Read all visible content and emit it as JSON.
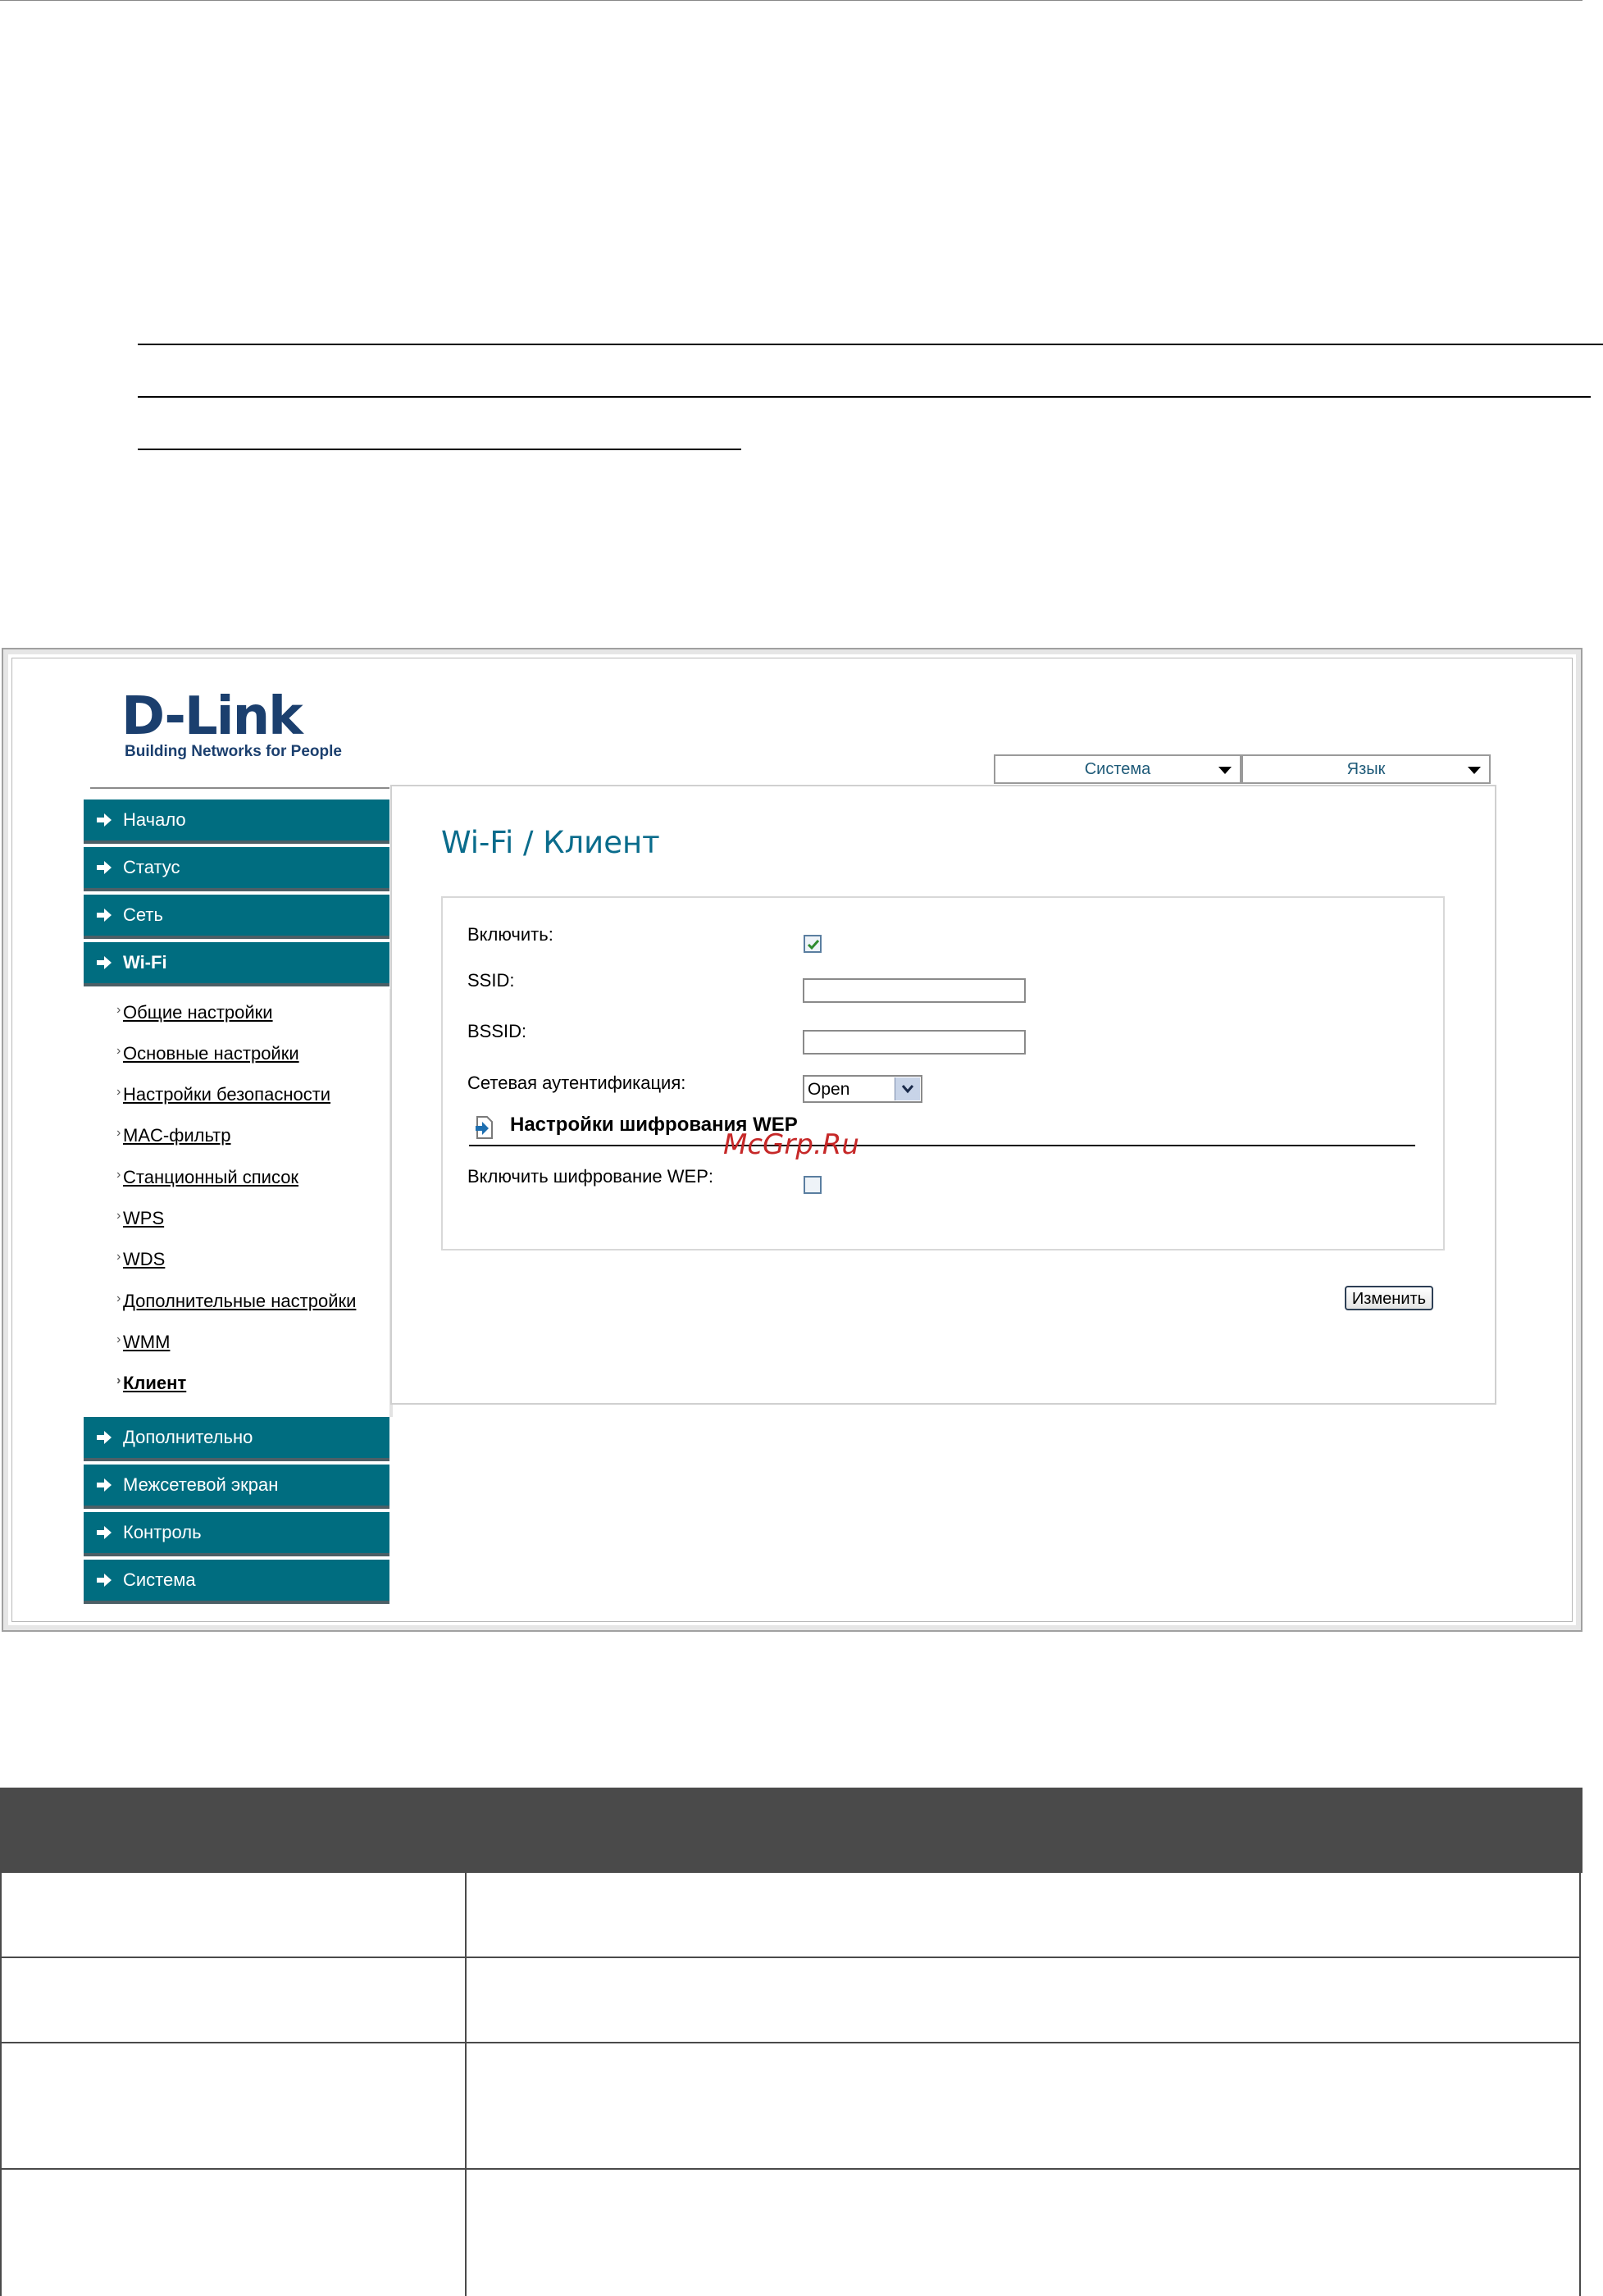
{
  "router": {
    "logo_main": "D-Link",
    "logo_tagline": "Building Networks for People",
    "top_menus": [
      "Система",
      "Язык"
    ],
    "sidebar": {
      "top_items": [
        "Начало",
        "Статус",
        "Сеть",
        "Wi-Fi"
      ],
      "wifi_subitems": [
        "Общие настройки",
        "Основные настройки",
        "Настройки безопасности",
        "MAC-фильтр",
        "Станционный список",
        "WPS",
        "WDS",
        "Дополнительные настройки",
        "WMM",
        "Клиент"
      ],
      "active_subitem": "Клиент",
      "bottom_items": [
        "Дополнительно",
        "Межсетевой экран",
        "Контроль",
        "Система"
      ]
    },
    "page_title": "Wi-Fi /  Клиент",
    "form": {
      "enable_label": "Включить:",
      "enable_checked": true,
      "ssid_label": "SSID:",
      "ssid_value": "",
      "bssid_label": "BSSID:",
      "bssid_value": "",
      "auth_label": "Сетевая аутентификация:",
      "auth_value": "Open",
      "wep_section_title": "Настройки шифрования WEP",
      "wep_enable_label": "Включить шифрование WEP:",
      "wep_enable_checked": false
    },
    "apply_label": "Изменить"
  },
  "watermark": "McGrp.Ru"
}
